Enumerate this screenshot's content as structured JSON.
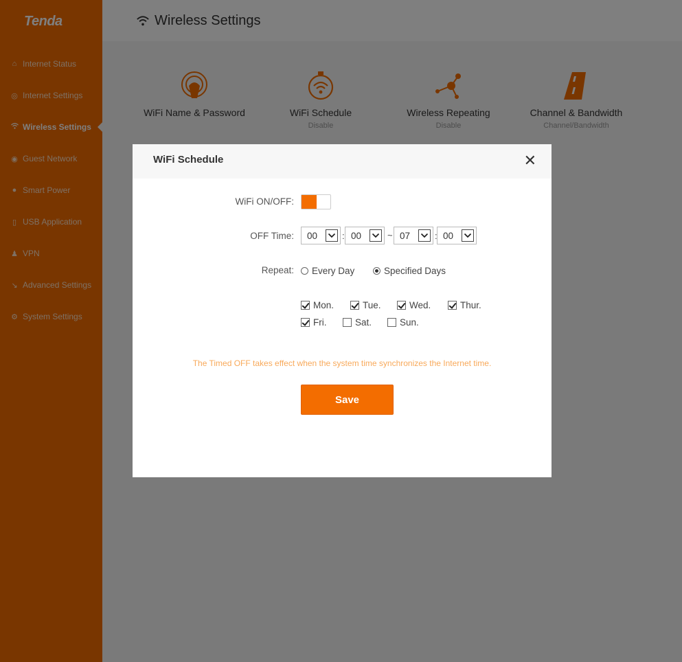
{
  "brand": "Tenda",
  "header": {
    "title": "Wireless Settings"
  },
  "nav": [
    {
      "label": "Internet Status",
      "icon": "status-icon"
    },
    {
      "label": "Internet Settings",
      "icon": "globe-icon"
    },
    {
      "label": "Wireless Settings",
      "icon": "wifi-icon",
      "active": true
    },
    {
      "label": "Guest Network",
      "icon": "guest-icon"
    },
    {
      "label": "Smart Power",
      "icon": "power-icon"
    },
    {
      "label": "USB Application",
      "icon": "usb-icon"
    },
    {
      "label": "VPN",
      "icon": "vpn-icon"
    },
    {
      "label": "Advanced Settings",
      "icon": "wrench-icon"
    },
    {
      "label": "System Settings",
      "icon": "gear-icon"
    }
  ],
  "tiles": [
    {
      "label": "WiFi Name & Password",
      "sub": "",
      "icon": "wifi-password-icon"
    },
    {
      "label": "WiFi Schedule",
      "sub": "Disable",
      "icon": "stopwatch-wifi-icon"
    },
    {
      "label": "Wireless Repeating",
      "sub": "Disable",
      "icon": "repeater-icon"
    },
    {
      "label": "Channel & Bandwidth",
      "sub": "Channel/Bandwidth",
      "icon": "road-icon"
    }
  ],
  "modal": {
    "title": "WiFi Schedule",
    "close": "✕",
    "wifi_label": "WiFi ON/OFF:",
    "wifi_on": true,
    "off_time_label": "OFF Time:",
    "off_time": {
      "start_hour": "00",
      "start_min": "00",
      "end_hour": "07",
      "end_min": "00"
    },
    "colon": ":",
    "tilde": "~",
    "repeat_label": "Repeat:",
    "repeat_options": [
      {
        "label": "Every Day",
        "checked": false
      },
      {
        "label": "Specified Days",
        "checked": true
      }
    ],
    "days": [
      {
        "label": "Mon.",
        "checked": true
      },
      {
        "label": "Tue.",
        "checked": true
      },
      {
        "label": "Wed.",
        "checked": true
      },
      {
        "label": "Thur.",
        "checked": true
      },
      {
        "label": "Fri.",
        "checked": true
      },
      {
        "label": "Sat.",
        "checked": false
      },
      {
        "label": "Sun.",
        "checked": false
      }
    ],
    "note": "The Timed OFF takes effect when the system time synchronizes the Internet time.",
    "save_label": "Save"
  },
  "colors": {
    "accent": "#f36d00",
    "note": "#f8a95a"
  }
}
